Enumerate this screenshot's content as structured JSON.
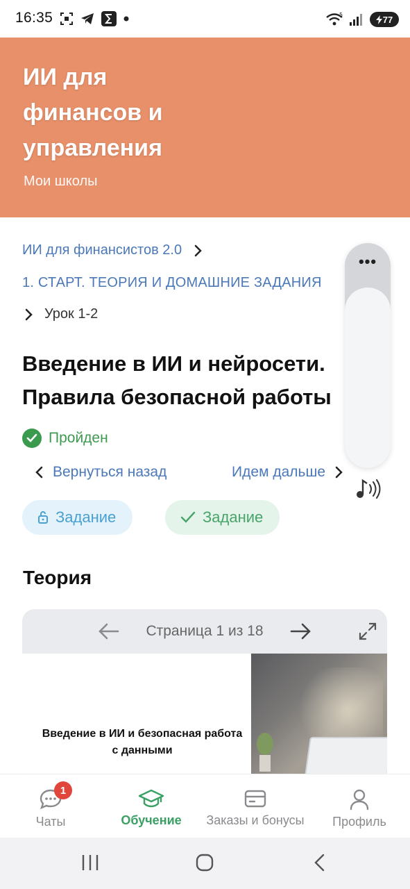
{
  "status_bar": {
    "time": "16:35",
    "battery": "77",
    "icons": [
      "screenshot-icon",
      "telegram-icon",
      "sigma-app-icon",
      "dot-icon",
      "wifi-icon",
      "signal-icon",
      "battery-icon"
    ]
  },
  "header": {
    "title": "ИИ для финансов и управления",
    "subtitle": "Мои школы",
    "bg_color": "#e8906a"
  },
  "breadcrumbs": {
    "course": "ИИ для финансистов 2.0",
    "module": "1. СТАРТ. ТЕОРИЯ И ДОМАШНИЕ ЗАДАНИЯ",
    "lesson": "Урок 1-2"
  },
  "lesson": {
    "title_line1": "Введение в ИИ и нейросети.",
    "title_line2": "Правила безопасной работы",
    "status": "Пройден"
  },
  "navigation": {
    "back_label": "Вернуться назад",
    "next_label": "Идем дальше"
  },
  "tasks": [
    {
      "label": "Задание",
      "icon": "lock-icon"
    },
    {
      "label": "Задание",
      "icon": "check-icon"
    }
  ],
  "theory": {
    "section_title": "Теория",
    "page_indicator": "Страница 1 из 18",
    "slide_title": "Введение в ИИ и безопасная работа с данными"
  },
  "floating_player": {
    "menu": "•••"
  },
  "bottom_nav": {
    "items": [
      {
        "label": "Чаты",
        "icon": "chat-icon",
        "badge": "1"
      },
      {
        "label": "Обучение",
        "icon": "graduation-cap-icon",
        "active": true
      },
      {
        "label": "Заказы и бонусы",
        "icon": "card-icon"
      },
      {
        "label": "Профиль",
        "icon": "profile-icon"
      }
    ],
    "active_color": "#3aa064"
  }
}
